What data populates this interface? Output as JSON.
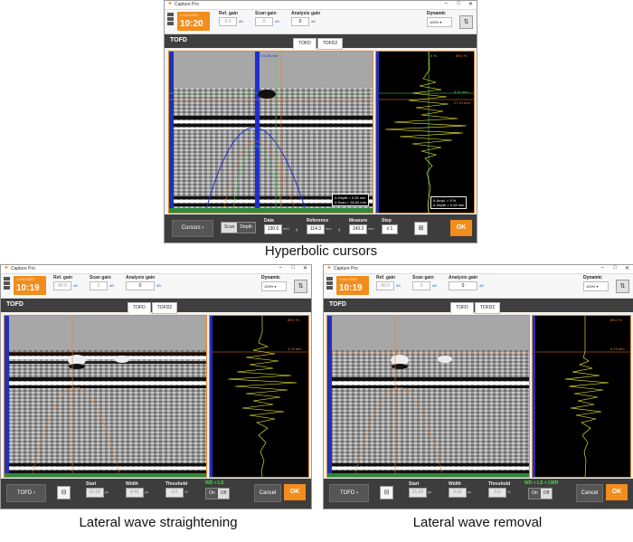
{
  "app_title": "Capture Pro",
  "windows": [
    {
      "id": "top",
      "time": "10:20",
      "date": "1 Oct 2020",
      "ref_gain_label": "Ref. gain",
      "ref_gain_value": "0.0",
      "scan_gain_label": "Scan gain",
      "scan_gain_value": "0",
      "analysis_gain_label": "Analysis gain",
      "analysis_gain_value": "0",
      "gain_unit": "dB",
      "dynamic_label": "Dynamic",
      "dynamic_value": "100%",
      "section_title": "TOFD",
      "tabs": [
        "TOFD",
        "TOFD2"
      ],
      "scan_labels": [
        "174.36 mm"
      ],
      "ascan_labels": [
        "5 %",
        "89.0 %",
        "6.21 mm",
        "27.13 mm"
      ],
      "meas_left": [
        "Δ Depth = 0.28 mm",
        "Δ Scan = 28.84 mm"
      ],
      "meas_right": [
        "Δ Ampl. = 5 %",
        "Δ Depth = 0.28 mm"
      ],
      "mode_button": "Cursors",
      "scan_toggle": [
        "Scan",
        "Depth"
      ],
      "data_label": "Data",
      "data_value": "130.0",
      "reference_label": "Reference",
      "reference_value": "114.3",
      "measure_label": "Measure",
      "measure_value": "143.2",
      "unit_mm": "mm",
      "step_label": "Step",
      "step_value": "x 1",
      "ok_label": "OK",
      "caption": "Hyperbolic cursors"
    },
    {
      "id": "bl",
      "time": "10:19",
      "date": "1 Oct 2020",
      "ref_gain_label": "Ref. gain",
      "ref_gain_value": "40.0",
      "scan_gain_label": "Scan gain",
      "scan_gain_value": "0",
      "analysis_gain_label": "Analysis gain",
      "analysis_gain_value": "0",
      "gain_unit": "dB",
      "dynamic_label": "Dynamic",
      "dynamic_value": "100%",
      "section_title": "TOFD",
      "tabs": [
        "TOFD",
        "TOFD2"
      ],
      "ascan_labels": [
        "89.0 %",
        "4.73 mm"
      ],
      "mode_button": "TOFD",
      "start_label": "Start",
      "start_value": "21.00",
      "width_label": "Width",
      "width_value": "0.41",
      "threshold_label": "Threshold",
      "threshold_value": "3.0",
      "unit_us": "µs",
      "unit_pct": "%",
      "wd_label": "WD + LS",
      "toggle": [
        "On",
        "Off"
      ],
      "cancel_label": "Cancel",
      "ok_label": "OK",
      "caption": "Lateral wave straightening"
    },
    {
      "id": "br",
      "time": "10:19",
      "date": "1 Oct 2020",
      "ref_gain_label": "Ref. gain",
      "ref_gain_value": "40.0",
      "scan_gain_label": "Scan gain",
      "scan_gain_value": "0",
      "analysis_gain_label": "Analysis gain",
      "analysis_gain_value": "0",
      "gain_unit": "dB",
      "dynamic_label": "Dynamic",
      "dynamic_value": "100%",
      "section_title": "TOFD",
      "tabs": [
        "TOFD",
        "TOFD2"
      ],
      "ascan_labels": [
        "89.0 %",
        "4.73 mm"
      ],
      "mode_button": "TOFD",
      "start_label": "Start",
      "start_value": "21.00",
      "width_label": "Width",
      "width_value": "0.41",
      "threshold_label": "Threshold",
      "threshold_value": "3.0",
      "unit_us": "µs",
      "unit_pct": "%",
      "wd_label": "WD + LS + LWR",
      "toggle": [
        "On",
        "Off"
      ],
      "cancel_label": "Cancel",
      "ok_label": "OK",
      "caption": "Lateral wave removal"
    }
  ],
  "colors": {
    "accent": "#f28c1c",
    "frame": "#e48a2b",
    "ascan_signal": "#ffff33",
    "cursor_blue": "#1e2fd1",
    "cursor_green": "#55dd55",
    "cursor_orange": "#ff7b20",
    "wd_green": "#44dd44"
  }
}
